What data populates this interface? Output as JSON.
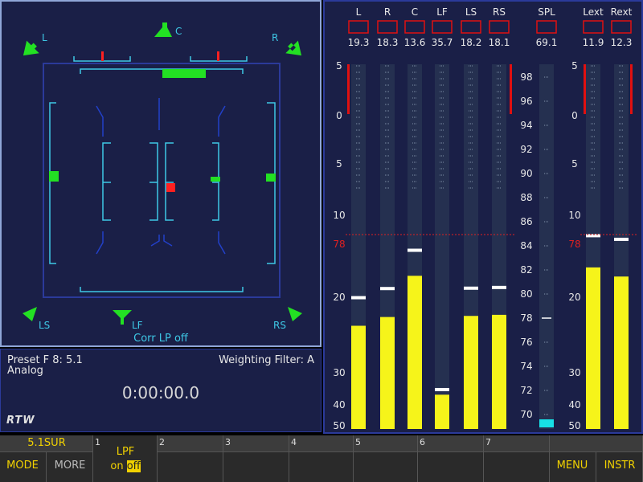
{
  "surround": {
    "speakers": {
      "L": "L",
      "C": "C",
      "R": "R",
      "LS": "LS",
      "LF": "LF",
      "RS": "RS"
    },
    "correlation_text": "Corr LP off",
    "colors": {
      "frame": "#2b3a9a",
      "lines": "#3ec8e6",
      "speaker": "#23e023",
      "phase": "#ff2020"
    }
  },
  "info": {
    "preset": "Preset F 8: 5.1",
    "source": "Analog",
    "weighting": "Weighting Filter: A",
    "timer": "0:00:00.0"
  },
  "logo": "RTW",
  "meters": {
    "channels": [
      {
        "name": "L",
        "value": "19.3",
        "level": 0.283,
        "peak": 0.36
      },
      {
        "name": "R",
        "value": "18.3",
        "level": 0.307,
        "peak": 0.385
      },
      {
        "name": "C",
        "value": "13.6",
        "level": 0.42,
        "peak": 0.49
      },
      {
        "name": "LF",
        "value": "35.7",
        "level": 0.094,
        "peak": 0.108
      },
      {
        "name": "LS",
        "value": "18.2",
        "level": 0.31,
        "peak": 0.386
      },
      {
        "name": "RS",
        "value": "18.1",
        "level": 0.313,
        "peak": 0.388
      }
    ],
    "spl": {
      "name": "SPL",
      "value": "69.1",
      "level": 0.022,
      "marker_value": 78
    },
    "ext_channels": [
      {
        "name": "Lext",
        "value": "11.9",
        "level": 0.443,
        "peak": 0.53
      },
      {
        "name": "Rext",
        "value": "12.3",
        "level": 0.418,
        "peak": 0.52
      }
    ],
    "db_scale": [
      "5",
      "0",
      "5",
      "10",
      "20",
      "30",
      "40",
      "50"
    ],
    "reference_label": "78",
    "spl_scale": [
      "98",
      "96",
      "94",
      "92",
      "90",
      "88",
      "86",
      "84",
      "82",
      "80",
      "78",
      "76",
      "74",
      "72",
      "70"
    ],
    "colors": {
      "bar": "#f6f41a",
      "peak": "#ffffff",
      "over": "#e01010",
      "ref": "#e02020",
      "spl": "#17e0e6"
    }
  },
  "bottom": {
    "mode_label": "5.1SUR",
    "slots": [
      "1",
      "2",
      "3",
      "4",
      "5",
      "6",
      "7"
    ],
    "buttons": {
      "mode": "MODE",
      "more": "MORE",
      "lpf_title": "LPF",
      "lpf_on": "on",
      "lpf_off": "off",
      "menu": "MENU",
      "instr": "INSTR"
    }
  }
}
